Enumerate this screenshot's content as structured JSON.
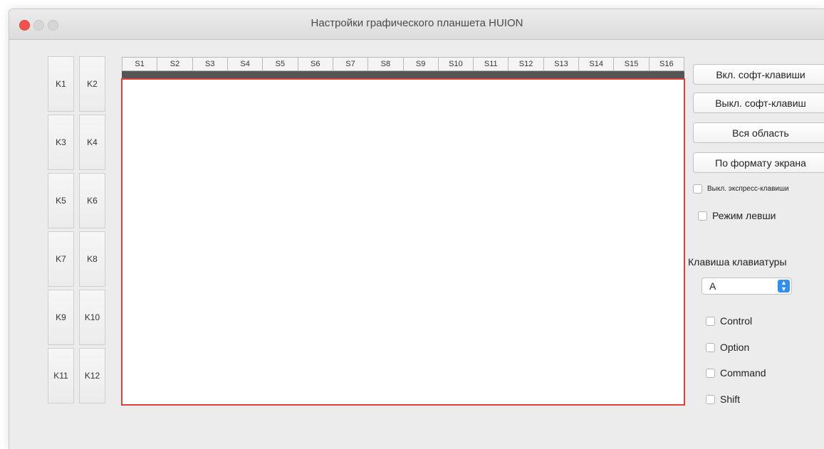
{
  "window": {
    "title": "Настройки графического планшета HUION"
  },
  "express_keys": [
    "K1",
    "K2",
    "K3",
    "K4",
    "K5",
    "K6",
    "K7",
    "K8",
    "K9",
    "K10",
    "K11",
    "K12"
  ],
  "soft_tabs": [
    "S1",
    "S2",
    "S3",
    "S4",
    "S5",
    "S6",
    "S7",
    "S8",
    "S9",
    "S10",
    "S11",
    "S12",
    "S13",
    "S14",
    "S15",
    "S16"
  ],
  "buttons": {
    "enable_soft_keys": "Вкл. софт-клавиши",
    "disable_soft_keys": "Выкл. софт-клавиш",
    "full_area": "Вся область",
    "screen_format": "По формату экрана"
  },
  "checkboxes": {
    "disable_express_keys": "Выкл. экспресс-клавиши",
    "left_hand_mode": "Режим левши"
  },
  "keyboard": {
    "label": "Клавиша клавиатуры",
    "selected_key": "A",
    "modifiers": [
      "Control",
      "Option",
      "Command",
      "Shift"
    ]
  },
  "colors": {
    "canvas_border": "#e0403a",
    "select_accent": "#2f8ff3",
    "close_button": "#f3514d"
  }
}
